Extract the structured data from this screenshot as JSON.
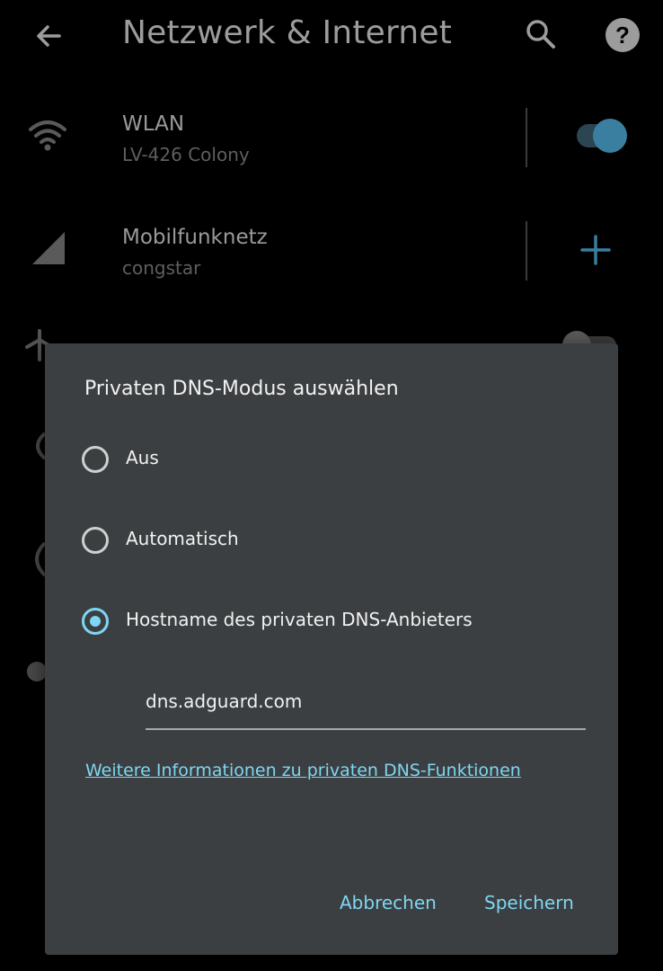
{
  "appbar": {
    "title": "Netzwerk & Internet",
    "back_icon": "arrow-back-icon",
    "search_icon": "search-icon",
    "help_icon": "help-icon"
  },
  "settings": [
    {
      "title": "WLAN",
      "subtitle": "LV-426 Colony",
      "icon": "wifi-icon",
      "control": "toggle-on"
    },
    {
      "title": "Mobilfunknetz",
      "subtitle": "congstar",
      "icon": "cellular-signal-icon",
      "control": "add"
    },
    {
      "title": "",
      "subtitle": "",
      "icon": "airplane-icon",
      "control": "toggle-off"
    }
  ],
  "dialog": {
    "title": "Privaten DNS-Modus auswählen",
    "options": [
      {
        "label": "Aus",
        "selected": false
      },
      {
        "label": "Automatisch",
        "selected": false
      },
      {
        "label": "Hostname des privaten DNS-Anbieters",
        "selected": true
      }
    ],
    "hostname_value": "dns.adguard.com",
    "info_link": "Weitere Informationen zu privaten DNS-Funktionen",
    "cancel_label": "Abbrechen",
    "save_label": "Speichern"
  },
  "colors": {
    "accent": "#7fd6f2",
    "dialog_bg": "#3c3f41",
    "toggle_on_thumb": "#3a7ea0",
    "plus_icon": "#3a7ea0"
  }
}
